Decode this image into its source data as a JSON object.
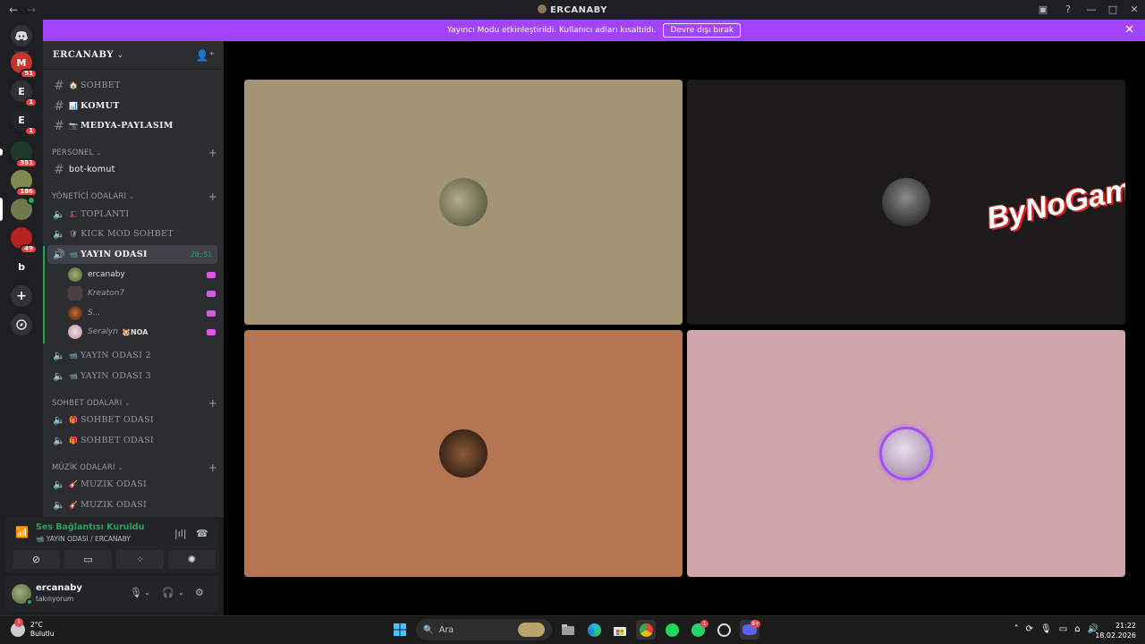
{
  "window": {
    "title": "ERCANABY",
    "nav_back": "←",
    "nav_forward": "→",
    "minimize": "—",
    "maximize": "□",
    "close": "✕",
    "inbox_icon": "inbox-icon",
    "help_icon": "?"
  },
  "banner": {
    "text": "Yayıncı Modu etkinleştirildi. Kullanıcı adları kısaltıldı.",
    "button": "Devre dışı bırak",
    "close": "✕"
  },
  "rail": {
    "home_icon": "discord-icon",
    "servers": [
      {
        "abbr": "M",
        "badge": "51",
        "color": "#c8322c"
      },
      {
        "abbr": "E",
        "badge": "1",
        "color": "#2f3136"
      },
      {
        "abbr": "E",
        "badge": "1",
        "color": "#222428"
      },
      {
        "abbr": "",
        "badge": "351",
        "color": "#1d3a2a"
      },
      {
        "abbr": "",
        "badge": "186",
        "color": "#7d8b4f"
      },
      {
        "abbr": "",
        "badge": "",
        "color": "#6f7a4a"
      },
      {
        "abbr": "",
        "badge": "49",
        "color": "#b5211e"
      },
      {
        "abbr": "b",
        "badge": "",
        "color": "#1e1f22"
      }
    ],
    "add_server": "+",
    "explore": "explore-icon"
  },
  "server": {
    "name": "ERCANABY",
    "chevron": "⌄",
    "invite_icon": "add-member-icon"
  },
  "text_channels_top": [
    {
      "emoji": "🏠",
      "name": "SOHBET"
    },
    {
      "emoji": "📊",
      "name": "KOMUT"
    },
    {
      "emoji": "📷",
      "name": "MEDYA-PAYLASIM"
    }
  ],
  "categories": {
    "personel": "PERSONEL",
    "yonetici": "YÖNETİCİ ODALARI",
    "sohbet": "SOHBET ODALARI",
    "muzik": "MÜZİK ODALARI"
  },
  "personel_channels": [
    {
      "name": "bot-komut"
    }
  ],
  "yonetici_channels": [
    {
      "emoji": "🎩",
      "name": "TOPLANTI"
    },
    {
      "emoji": "🛡",
      "name": "KICK MOD SOHBET"
    }
  ],
  "active_channel": {
    "emoji": "📹",
    "name": "YAYIN ODASI",
    "timer": "20:51"
  },
  "voice_members": [
    {
      "name": "ercanaby",
      "color": "#6b7d45",
      "tag": ""
    },
    {
      "name": "Kreaton7",
      "color": "#6e5a5a",
      "tag": ""
    },
    {
      "name": "S...",
      "color": "#8a4a2a",
      "tag": ""
    },
    {
      "name": "Seralyn",
      "color": "#c8a8b0",
      "tag": "🐹NOA"
    }
  ],
  "yayin_channels": [
    {
      "emoji": "📹",
      "name": "YAYIN ODASI 2"
    },
    {
      "emoji": "📹",
      "name": "YAYIN ODASI 3"
    }
  ],
  "sohbet_channels": [
    {
      "emoji": "🎁",
      "name": "SOHBET ODASI"
    },
    {
      "emoji": "🎁",
      "name": "SOHBET ODASI"
    }
  ],
  "muzik_channels": [
    {
      "emoji": "🎸",
      "name": "MUZIK ODASI"
    },
    {
      "emoji": "🎸",
      "name": "MUZIK ODASI"
    }
  ],
  "voice": {
    "status": "Ses Bağlantısı Kuruldu",
    "location": "📹 YAYIN ODASI / ERCANABY"
  },
  "user": {
    "name": "ercanaby",
    "status": "takılıyorum"
  },
  "tiles": [
    {
      "bg": "#a39474",
      "avatar": "#4e5a3a",
      "speaking": true
    },
    {
      "bg": "#1c1a1a",
      "avatar": "#3a3a3a",
      "speaking": false,
      "watermark": "ByNoGam"
    },
    {
      "bg": "#b37650",
      "avatar": "#3a2618",
      "speaking": false
    },
    {
      "bg": "#cfa7ab",
      "avatar": "#b9a8c8",
      "speaking": false
    }
  ],
  "taskbar": {
    "temp": "2°C",
    "condition": "Bulutlu",
    "weather_badge": "1",
    "search": "Ara",
    "time": "21:22",
    "date": "18.02.2026",
    "whatsapp_badge": "1",
    "discord_badge": "9+"
  }
}
